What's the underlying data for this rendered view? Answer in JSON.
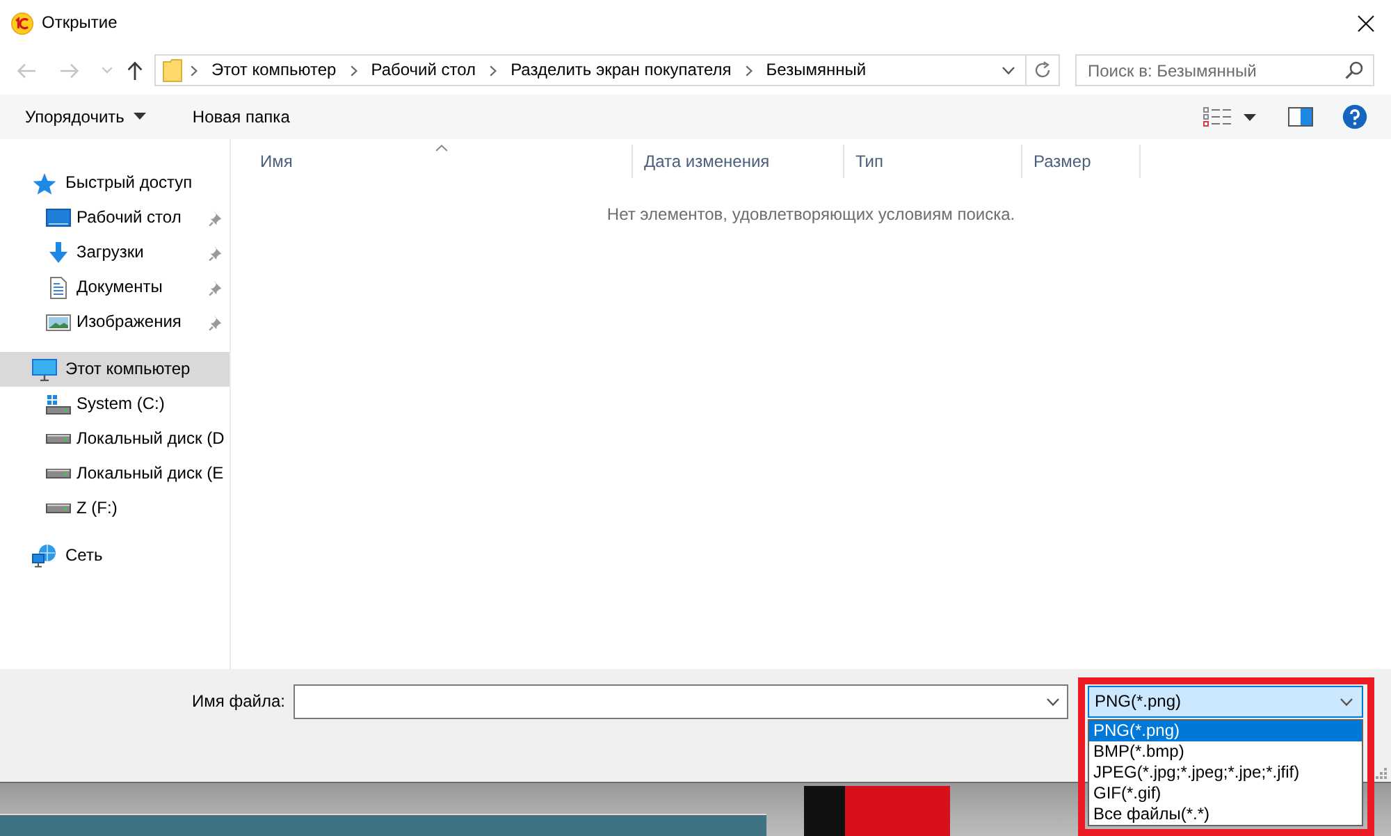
{
  "window": {
    "title": "Открытие"
  },
  "nav_buttons": [
    {
      "kind": "back",
      "disabled": true
    },
    {
      "kind": "forward",
      "disabled": true
    },
    {
      "kind": "recent",
      "disabled": true
    },
    {
      "kind": "up",
      "disabled": false
    }
  ],
  "address_bar": {
    "crumbs": [
      "Этот компьютер",
      "Рабочий стол",
      "Разделить экран покупателя",
      "Безымянный"
    ]
  },
  "search": {
    "placeholder": "Поиск в: Безымянный"
  },
  "toolbar": {
    "organize": "Упорядочить",
    "new_folder": "Новая папка"
  },
  "sidebar": {
    "items": [
      {
        "label": "Быстрый доступ",
        "kind": "quick-access",
        "selected": false,
        "children": [
          {
            "label": "Рабочий стол",
            "kind": "desktop",
            "selected": false,
            "pinned": true
          },
          {
            "label": "Загрузки",
            "kind": "downloads",
            "selected": false,
            "pinned": true
          },
          {
            "label": "Документы",
            "kind": "documents",
            "selected": false,
            "pinned": true
          },
          {
            "label": "Изображения",
            "kind": "pictures",
            "selected": false,
            "pinned": true
          }
        ]
      },
      {
        "label": "Этот компьютер",
        "kind": "computer",
        "selected": true,
        "children": [
          {
            "label": "System (C:)",
            "kind": "system-drive",
            "selected": false
          },
          {
            "label": "Локальный диск (D",
            "kind": "drive",
            "selected": false
          },
          {
            "label": "Локальный диск (E",
            "kind": "drive",
            "selected": false
          },
          {
            "label": "Z (F:)",
            "kind": "drive",
            "selected": false
          }
        ]
      },
      {
        "label": "Сеть",
        "kind": "network",
        "selected": false
      }
    ]
  },
  "table": {
    "columns": [
      {
        "label": "Имя",
        "sorted": true
      },
      {
        "label": "Дата изменения",
        "sorted": false
      },
      {
        "label": "Тип",
        "sorted": false
      },
      {
        "label": "Размер",
        "sorted": false
      }
    ],
    "empty_message": "Нет элементов, удовлетворяющих условиям поиска."
  },
  "file_name": {
    "label": "Имя файла:"
  },
  "file_type": {
    "value": "PNG(*.png)",
    "expanded": true,
    "options": [
      {
        "label": "PNG(*.png)",
        "selected": true
      },
      {
        "label": "BMP(*.bmp)",
        "selected": false
      },
      {
        "label": "JPEG(*.jpg;*.jpeg;*.jpe;*.jfif)",
        "selected": false
      },
      {
        "label": "GIF(*.gif)",
        "selected": false
      },
      {
        "label": "Все файлы(*.*)",
        "selected": false
      }
    ]
  }
}
